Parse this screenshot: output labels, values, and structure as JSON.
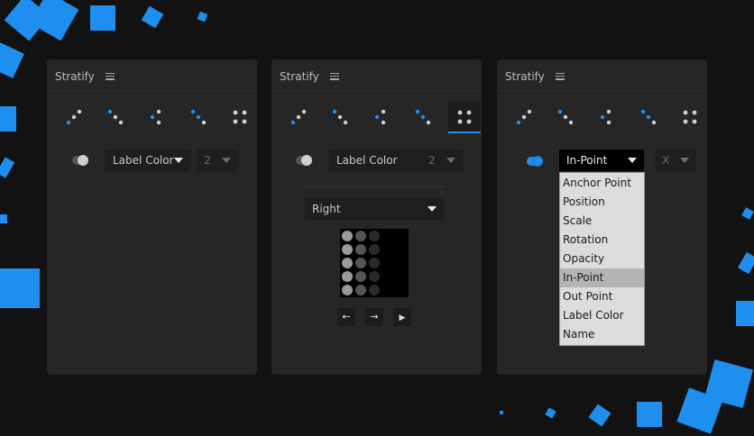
{
  "panels": [
    {
      "title": "Stratify",
      "toggle_on": false,
      "property": "Label Color",
      "count": "2"
    },
    {
      "title": "Stratify",
      "toggle_on": false,
      "property": "Label Color",
      "count": "2",
      "direction": "Right",
      "buttons": [
        "←",
        "→",
        "▶"
      ]
    },
    {
      "title": "Stratify",
      "toggle_on": true,
      "property": "In-Point",
      "axis": "X",
      "menu_items": [
        "Anchor Point",
        "Position",
        "Scale",
        "Rotation",
        "Opacity",
        "In-Point",
        "Out Point",
        "Label Color",
        "Name"
      ],
      "menu_selected": "In-Point"
    }
  ],
  "modes": [
    "diagonal-up-dots",
    "diagonal-down-dots",
    "vertical-dots",
    "diagonal-down-dots-alt",
    "grid-dots"
  ],
  "active_mode_panel_2": "grid-dots",
  "colors": {
    "accent": "#1e8fef",
    "panel": "#262626",
    "background": "#121212"
  }
}
